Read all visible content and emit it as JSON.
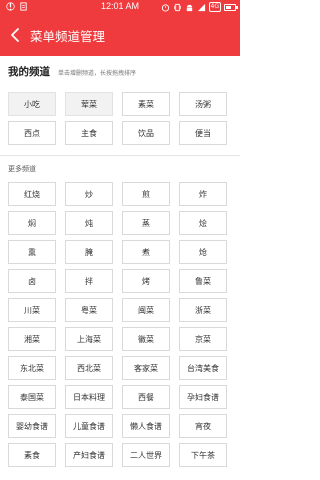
{
  "status_bar": {
    "time": "12:01 AM",
    "network_badge": "4G"
  },
  "header": {
    "title": "菜单频道管理"
  },
  "my_channels": {
    "title": "我的频道",
    "hint": "单击增删频道，长按拖拽排序",
    "items": [
      {
        "label": "小吃",
        "fixed": true
      },
      {
        "label": "荤菜",
        "fixed": true
      },
      {
        "label": "素菜",
        "fixed": false
      },
      {
        "label": "汤粥",
        "fixed": false
      },
      {
        "label": "西点",
        "fixed": false
      },
      {
        "label": "主食",
        "fixed": false
      },
      {
        "label": "饮品",
        "fixed": false
      },
      {
        "label": "便当",
        "fixed": false
      }
    ]
  },
  "more_channels": {
    "title": "更多频道",
    "items": [
      "红烧",
      "炒",
      "煎",
      "炸",
      "焖",
      "炖",
      "蒸",
      "烩",
      "熏",
      "腌",
      "煮",
      "炝",
      "卤",
      "拌",
      "烤",
      "鲁菜",
      "川菜",
      "粤菜",
      "闽菜",
      "浙菜",
      "湘菜",
      "上海菜",
      "徽菜",
      "京菜",
      "东北菜",
      "西北菜",
      "客家菜",
      "台湾美食",
      "泰国菜",
      "日本料理",
      "西餐",
      "孕妇食谱",
      "婴幼食谱",
      "儿童食谱",
      "懒人食谱",
      "宵夜",
      "素食",
      "产妇食谱",
      "二人世界",
      "下午茶"
    ]
  },
  "colors": {
    "brand": "#ef3b3d"
  }
}
